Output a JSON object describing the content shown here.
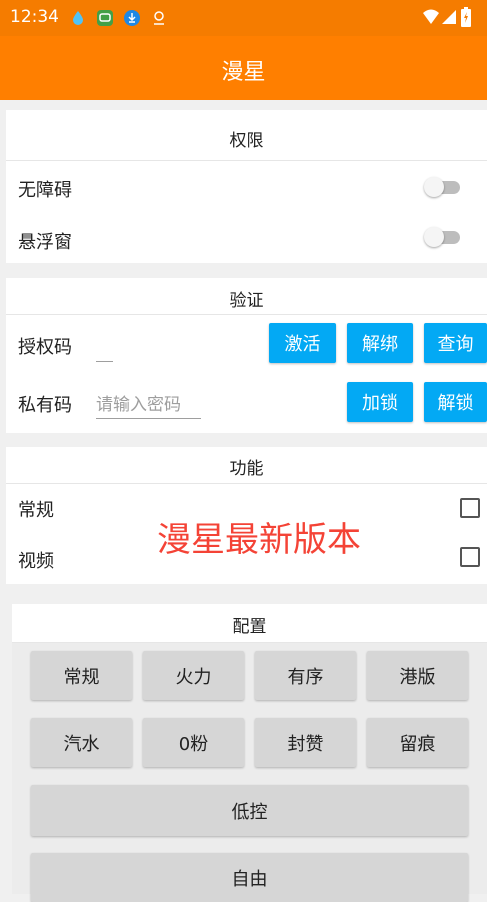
{
  "status_bar": {
    "time": "12:34",
    "left_icons": [
      "drop-icon",
      "message-icon",
      "download-icon",
      "location-icon"
    ],
    "right_icons": [
      "wifi-icon",
      "signal-icon",
      "battery-icon"
    ]
  },
  "app_bar": {
    "title": "漫星"
  },
  "permissions": {
    "title": "权限",
    "items": [
      {
        "label": "无障碍",
        "enabled": false
      },
      {
        "label": "悬浮窗",
        "enabled": false
      }
    ]
  },
  "verification": {
    "title": "验证",
    "auth_code_label": "授权码",
    "auth_code_value": "",
    "activate_label": "激活",
    "unbind_label": "解绑",
    "query_label": "查询",
    "private_code_label": "私有码",
    "private_code_placeholder": "请输入密码",
    "lock_label": "加锁",
    "unlock_label": "解锁"
  },
  "functions": {
    "title": "功能",
    "items": [
      {
        "label": "常规",
        "checked": false
      },
      {
        "label": "视频",
        "checked": false
      }
    ],
    "promo_text": "漫星最新版本"
  },
  "config": {
    "title": "配置",
    "buttons": [
      "常规",
      "火力",
      "有序",
      "港版",
      "汽水",
      "0粉",
      "封赞",
      "留痕"
    ],
    "wide_buttons": [
      "低控",
      "自由"
    ]
  },
  "colors": {
    "status_bar": "#f57c00",
    "app_bar": "#ff7f00",
    "accent_button": "#03a9f4",
    "promo_text": "#f44336",
    "grey_button": "#d6d6d6"
  }
}
